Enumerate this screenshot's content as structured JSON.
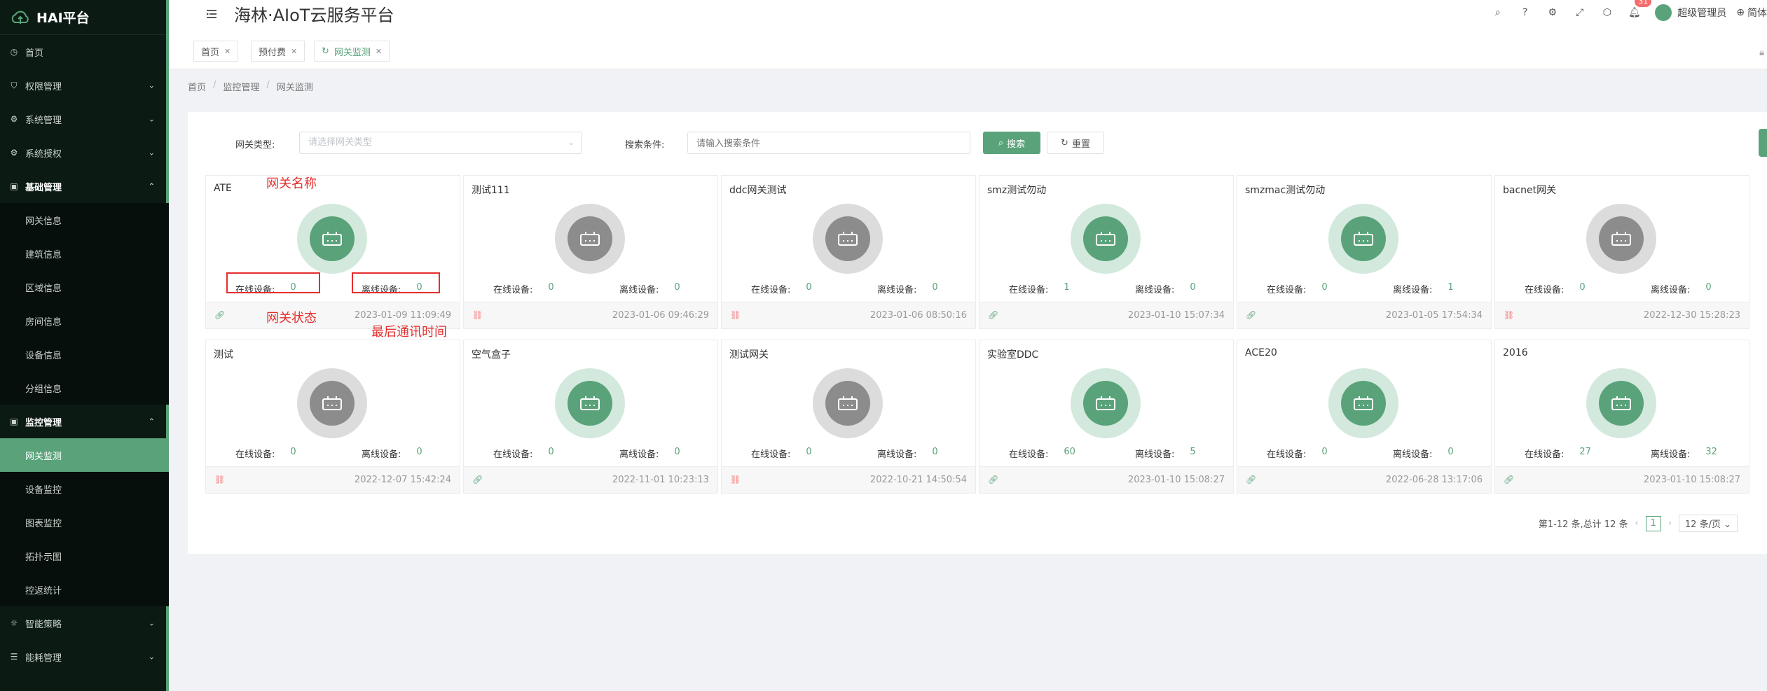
{
  "sidebar": {
    "logo": "HAI平台",
    "items": [
      {
        "label": "首页",
        "icon": "clock-icon"
      },
      {
        "label": "权限管理",
        "icon": "shield-icon"
      },
      {
        "label": "系统管理",
        "icon": "settings-icon"
      },
      {
        "label": "系统授权",
        "icon": "settings-icon"
      },
      {
        "label": "基础管理",
        "icon": "folder-icon"
      },
      {
        "label": "网关信息"
      },
      {
        "label": "建筑信息"
      },
      {
        "label": "区域信息"
      },
      {
        "label": "房间信息"
      },
      {
        "label": "设备信息"
      },
      {
        "label": "分组信息"
      },
      {
        "label": "监控管理",
        "icon": "monitor-icon"
      },
      {
        "label": "网关监测"
      },
      {
        "label": "设备监控"
      },
      {
        "label": "图表监控"
      },
      {
        "label": "拓扑示图"
      },
      {
        "label": "控返统计"
      },
      {
        "label": "智能策略",
        "icon": "bulb-icon"
      },
      {
        "label": "能耗管理",
        "icon": "sliders-icon"
      }
    ]
  },
  "header": {
    "title": "海林·AIoT云服务平台",
    "notification_count": "31",
    "user_name": "超级管理员",
    "lang": "简体"
  },
  "tabs": [
    {
      "label": "首页"
    },
    {
      "label": "预付费"
    },
    {
      "label": "网关监测"
    }
  ],
  "breadcrumb": [
    "首页",
    "监控管理",
    "网关监测"
  ],
  "filter": {
    "type_label": "网关类型:",
    "type_placeholder": "请选择网关类型",
    "search_label": "搜索条件:",
    "search_placeholder": "请输入搜索条件",
    "search_button": "搜索",
    "reset_button": "重置"
  },
  "labels": {
    "online": "在线设备:",
    "offline": "离线设备:"
  },
  "cards": [
    {
      "name": "ATE",
      "online": "0",
      "offline": "0",
      "status": "online",
      "time": "2023-01-09 11:09:49"
    },
    {
      "name": "测试111",
      "online": "0",
      "offline": "0",
      "status": "offline",
      "time": "2023-01-06 09:46:29"
    },
    {
      "name": "ddc网关测试",
      "online": "0",
      "offline": "0",
      "status": "offline",
      "time": "2023-01-06 08:50:16"
    },
    {
      "name": "smz测试勿动",
      "online": "1",
      "offline": "0",
      "status": "online",
      "time": "2023-01-10 15:07:34"
    },
    {
      "name": "smzmac测试勿动",
      "online": "0",
      "offline": "1",
      "status": "online",
      "time": "2023-01-05 17:54:34"
    },
    {
      "name": "bacnet网关",
      "online": "0",
      "offline": "0",
      "status": "offline",
      "time": "2022-12-30 15:28:23"
    },
    {
      "name": "测试",
      "online": "0",
      "offline": "0",
      "status": "offline",
      "time": "2022-12-07 15:42:24"
    },
    {
      "name": "空气盒子",
      "online": "0",
      "offline": "0",
      "status": "online",
      "time": "2022-11-01 10:23:13"
    },
    {
      "name": "测试网关",
      "online": "0",
      "offline": "0",
      "status": "offline",
      "time": "2022-10-21 14:50:54"
    },
    {
      "name": "实验室DDC",
      "online": "60",
      "offline": "5",
      "status": "online",
      "time": "2023-01-10 15:08:27"
    },
    {
      "name": "ACE20",
      "online": "0",
      "offline": "0",
      "status": "online",
      "time": "2022-06-28 13:17:06"
    },
    {
      "name": "2016",
      "online": "27",
      "offline": "32",
      "status": "online",
      "time": "2023-01-10 15:08:27"
    }
  ],
  "annotations": {
    "name": "网关名称",
    "status": "网关状态",
    "last_time": "最后通讯时间"
  },
  "pagination": {
    "summary": "第1-12 条,总计 12 条",
    "current": "1",
    "page_size": "12 条/页"
  },
  "colors": {
    "accent": "#5aa37a",
    "sidebar_bg": "#0c1a14",
    "annotation": "#e62e2e"
  }
}
